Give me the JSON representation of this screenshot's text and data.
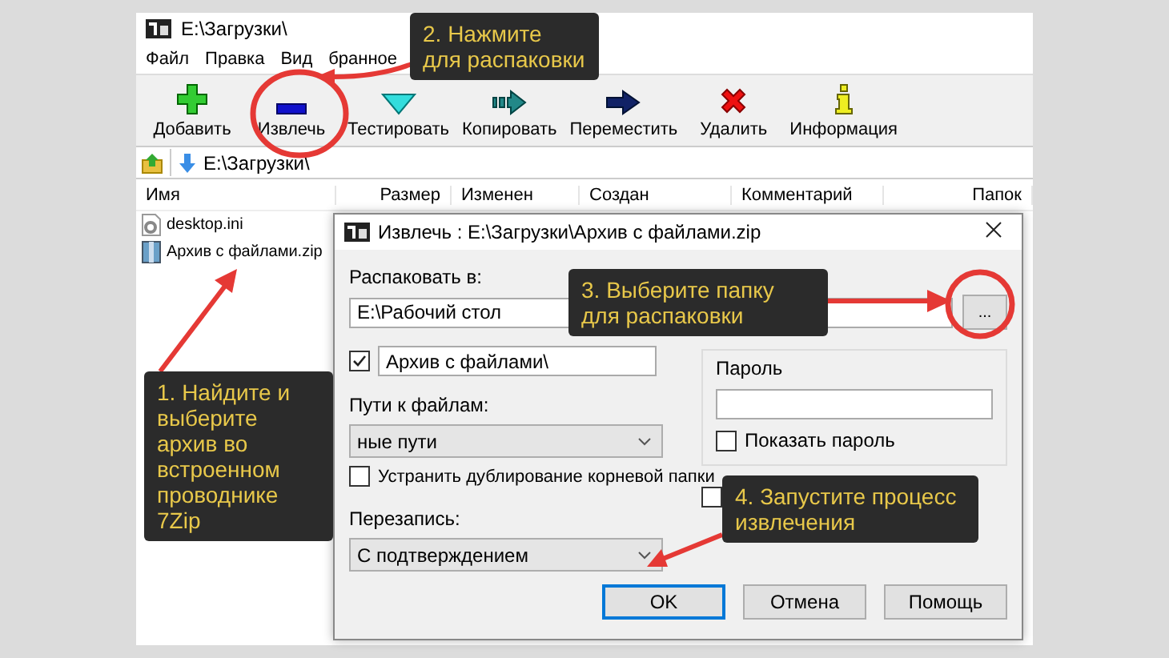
{
  "window": {
    "title": "E:\\Загрузки\\"
  },
  "menu": [
    "Файл",
    "Правка",
    "Вид",
    "бранное"
  ],
  "toolbar": [
    {
      "label": "Добавить"
    },
    {
      "label": "Извлечь"
    },
    {
      "label": "Тестировать"
    },
    {
      "label": "Копировать"
    },
    {
      "label": "Переместить"
    },
    {
      "label": "Удалить"
    },
    {
      "label": "Информация"
    }
  ],
  "address": {
    "path": "E:\\Загрузки\\"
  },
  "table": {
    "columns": [
      "Имя",
      "Размер",
      "Изменен",
      "Создан",
      "Комментарий",
      "Папок"
    ],
    "rows": [
      {
        "kind": "ini",
        "name": "desktop.ini"
      },
      {
        "kind": "zip",
        "name": "Архив с файлами.zip"
      }
    ]
  },
  "dialog": {
    "title": "Извлечь : E:\\Загрузки\\Архив с файлами.zip",
    "extract_to_label": "Распаковать в:",
    "extract_to": "E:\\Рабочий стол",
    "browse": "...",
    "subfolder": {
      "checked": true,
      "value": "Архив с файлами\\"
    },
    "paths_label": "Пути к файлам:",
    "paths_value": "ные пути",
    "eliminate_root": {
      "checked": false,
      "label": "Устранить дублирование корневой папки"
    },
    "overwrite_label": "Перезапись:",
    "overwrite_value": "С подтверждением",
    "password": {
      "label": "Пароль",
      "show": {
        "checked": false,
        "label": "Показать пароль"
      }
    },
    "extra_option": {
      "checked": false
    },
    "buttons": [
      {
        "label": "OK",
        "selected": true
      },
      {
        "label": "Отмена",
        "selected": false
      },
      {
        "label": "Помощь",
        "selected": false
      }
    ]
  },
  "callouts": [
    "1. Найдите и выберите архив во встроенном проводнике 7Zip",
    "2. Нажмите для распаковки",
    "3. Выберите папку для распаковки",
    "4. Запустите процесс извлечения"
  ]
}
